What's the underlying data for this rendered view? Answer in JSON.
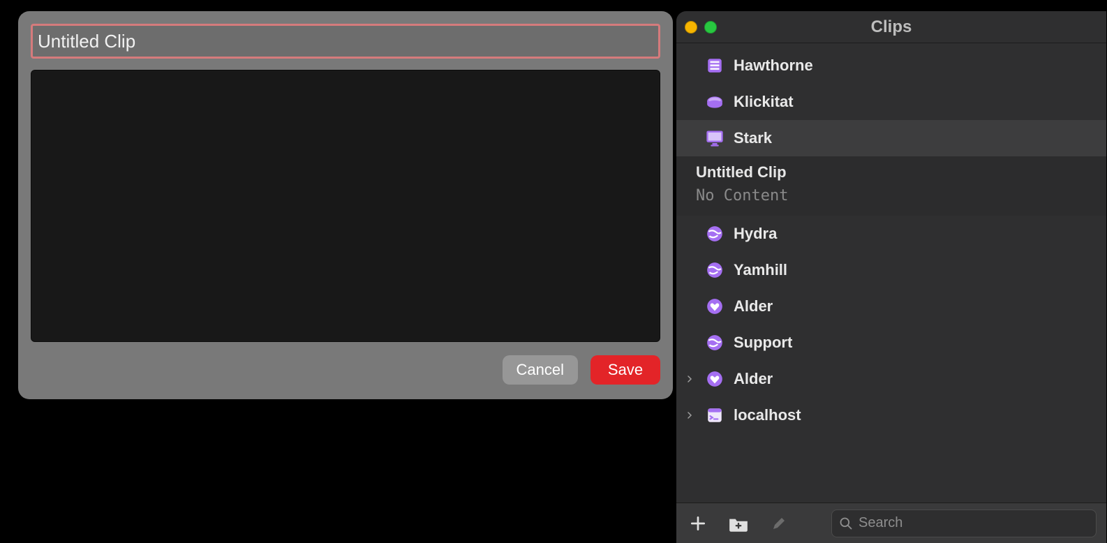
{
  "dialog": {
    "title_value": "Untitled Clip",
    "title_placeholder": "Untitled Clip",
    "content_value": "",
    "cancel_label": "Cancel",
    "save_label": "Save"
  },
  "panel": {
    "title": "Clips",
    "items": [
      {
        "label": "Hawthorne",
        "icon": "book-icon",
        "expandable": false
      },
      {
        "label": "Klickitat",
        "icon": "disc-icon",
        "expandable": false
      },
      {
        "label": "Stark",
        "icon": "display-icon",
        "expandable": false,
        "selected": true
      },
      {
        "label": "Hydra",
        "icon": "globe-icon",
        "expandable": false
      },
      {
        "label": "Yamhill",
        "icon": "globe-icon",
        "expandable": false
      },
      {
        "label": "Alder",
        "icon": "heart-icon",
        "expandable": false
      },
      {
        "label": "Support",
        "icon": "globe-icon",
        "expandable": false
      },
      {
        "label": "Alder",
        "icon": "heart-icon",
        "expandable": true
      },
      {
        "label": "localhost",
        "icon": "terminal-icon",
        "expandable": true
      }
    ],
    "expansion": {
      "title": "Untitled Clip",
      "subtitle": "No Content"
    },
    "search_placeholder": "Search"
  }
}
